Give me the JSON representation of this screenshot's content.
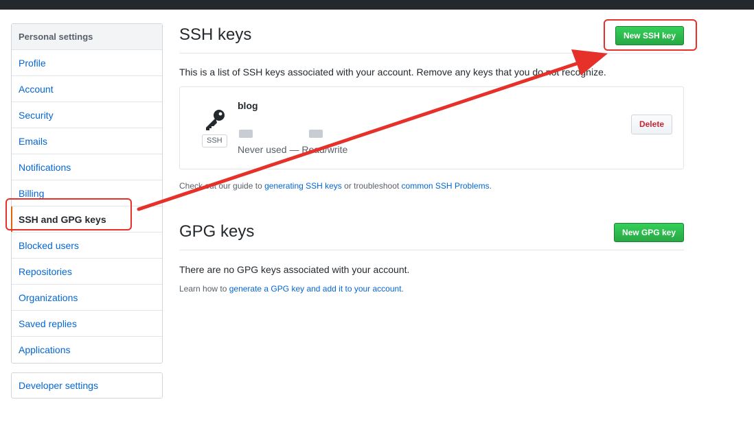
{
  "sidebar": {
    "heading": "Personal settings",
    "items": [
      {
        "label": "Profile"
      },
      {
        "label": "Account"
      },
      {
        "label": "Security"
      },
      {
        "label": "Emails"
      },
      {
        "label": "Notifications"
      },
      {
        "label": "Billing"
      },
      {
        "label": "SSH and GPG keys",
        "selected": true
      },
      {
        "label": "Blocked users"
      },
      {
        "label": "Repositories"
      },
      {
        "label": "Organizations"
      },
      {
        "label": "Saved replies"
      },
      {
        "label": "Applications"
      }
    ],
    "developer_settings": "Developer settings"
  },
  "ssh": {
    "title": "SSH keys",
    "new_button": "New SSH key",
    "description": "This is a list of SSH keys associated with your account. Remove any keys that you do not recognize.",
    "key": {
      "title": "blog",
      "type_badge": "SSH",
      "status": "Never used — Read/write",
      "delete_button": "Delete"
    },
    "guide": {
      "prefix": "Check out our guide to ",
      "link1": "generating SSH keys",
      "middle": " or troubleshoot ",
      "link2": "common SSH Problems",
      "suffix": "."
    }
  },
  "gpg": {
    "title": "GPG keys",
    "new_button": "New GPG key",
    "empty_text": "There are no GPG keys associated with your account.",
    "learn": {
      "prefix": "Learn how to ",
      "link": "generate a GPG key and add it to your account",
      "suffix": "."
    }
  },
  "colors": {
    "accent": "#0366d6",
    "primary_button": "#28a745",
    "danger": "#cb2431",
    "selected_marker": "#e36209",
    "annotation": "#e5312a"
  },
  "icons": {
    "key": "key-icon"
  }
}
